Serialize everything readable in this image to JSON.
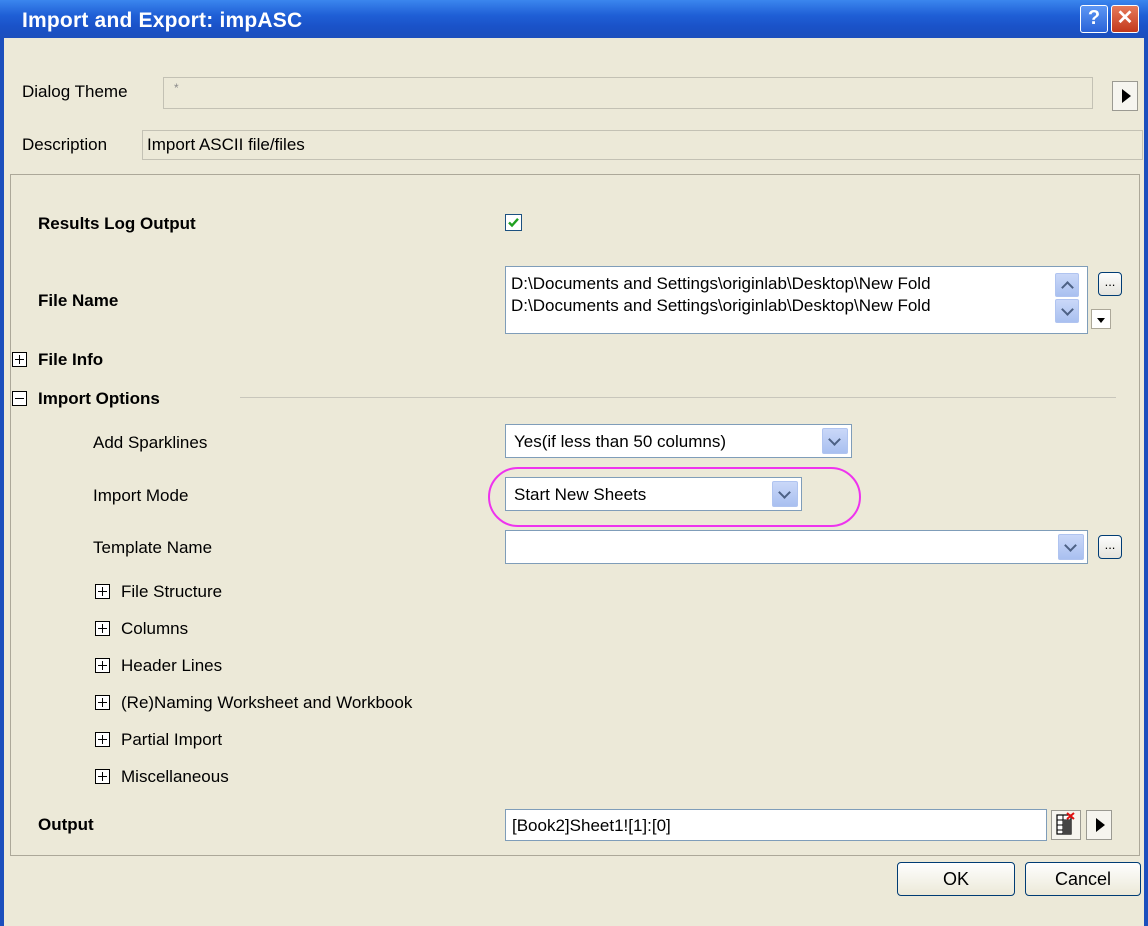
{
  "window": {
    "title": "Import and Export: impASC",
    "help_label": "?",
    "close_label": "✕"
  },
  "dialog_theme": {
    "label": "Dialog Theme",
    "value": "*"
  },
  "description": {
    "label": "Description",
    "value": "Import ASCII file/files"
  },
  "results_log": {
    "label": "Results Log Output",
    "checked": true
  },
  "file_name": {
    "label": "File Name",
    "lines": [
      "D:\\Documents and Settings\\originlab\\Desktop\\New Fold",
      "D:\\Documents and Settings\\originlab\\Desktop\\New Fold"
    ],
    "browse_label": "..."
  },
  "file_info": {
    "label": "File Info",
    "expanded": false
  },
  "import_options": {
    "label": "Import Options",
    "expanded": true,
    "add_sparklines": {
      "label": "Add Sparklines",
      "value": "Yes(if less than 50 columns)"
    },
    "import_mode": {
      "label": "Import Mode",
      "value": "Start New Sheets"
    },
    "template_name": {
      "label": "Template Name",
      "value": "",
      "browse_label": "..."
    },
    "subgroups": [
      "File Structure",
      "Columns",
      "Header Lines",
      "(Re)Naming Worksheet and Workbook",
      "Partial Import",
      "Miscellaneous"
    ]
  },
  "output": {
    "label": "Output",
    "value": "[Book2]Sheet1![1]:[0]"
  },
  "buttons": {
    "ok": "OK",
    "cancel": "Cancel"
  },
  "colors": {
    "titlebar": "#1f5fd6",
    "dialog_bg": "#ece9d8",
    "highlight": "#ee33ee",
    "check": "#21a121"
  }
}
